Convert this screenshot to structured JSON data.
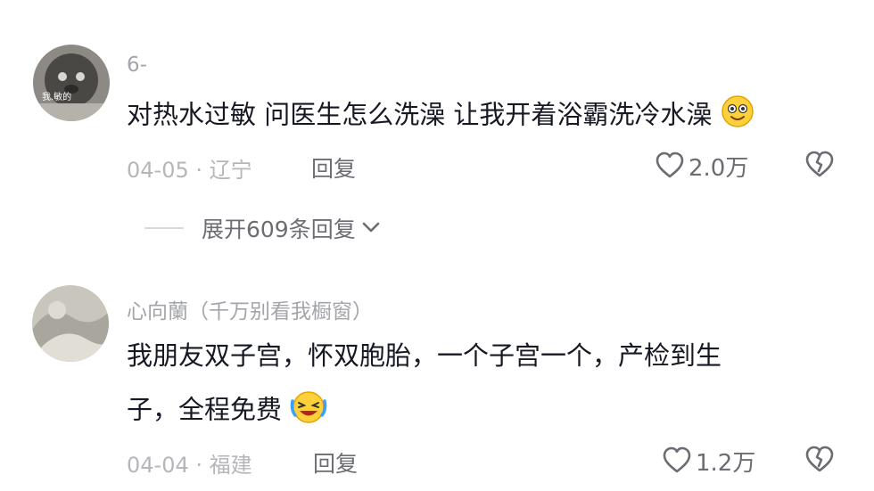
{
  "comments": [
    {
      "username": "6-",
      "text": "对热水过敏 问医生怎么洗澡 让我开着浴霸洗冷水澡",
      "date_location": "04-05 · 辽宁",
      "reply_label": "回复",
      "likes": "2.0万",
      "emoji": "smiling-face-icon"
    },
    {
      "username": "心向蘭（千万别看我橱窗）",
      "text_line1": "我朋友双子宫，怀双胞胎，一个子宫一个，产检到生",
      "text_line2": "子，全程免费",
      "date_location": "04-04 · 福建",
      "reply_label": "回复",
      "likes": "1.2万",
      "emoji": "laughing-crying-face-icon"
    }
  ],
  "expand_replies": "展开609条回复"
}
